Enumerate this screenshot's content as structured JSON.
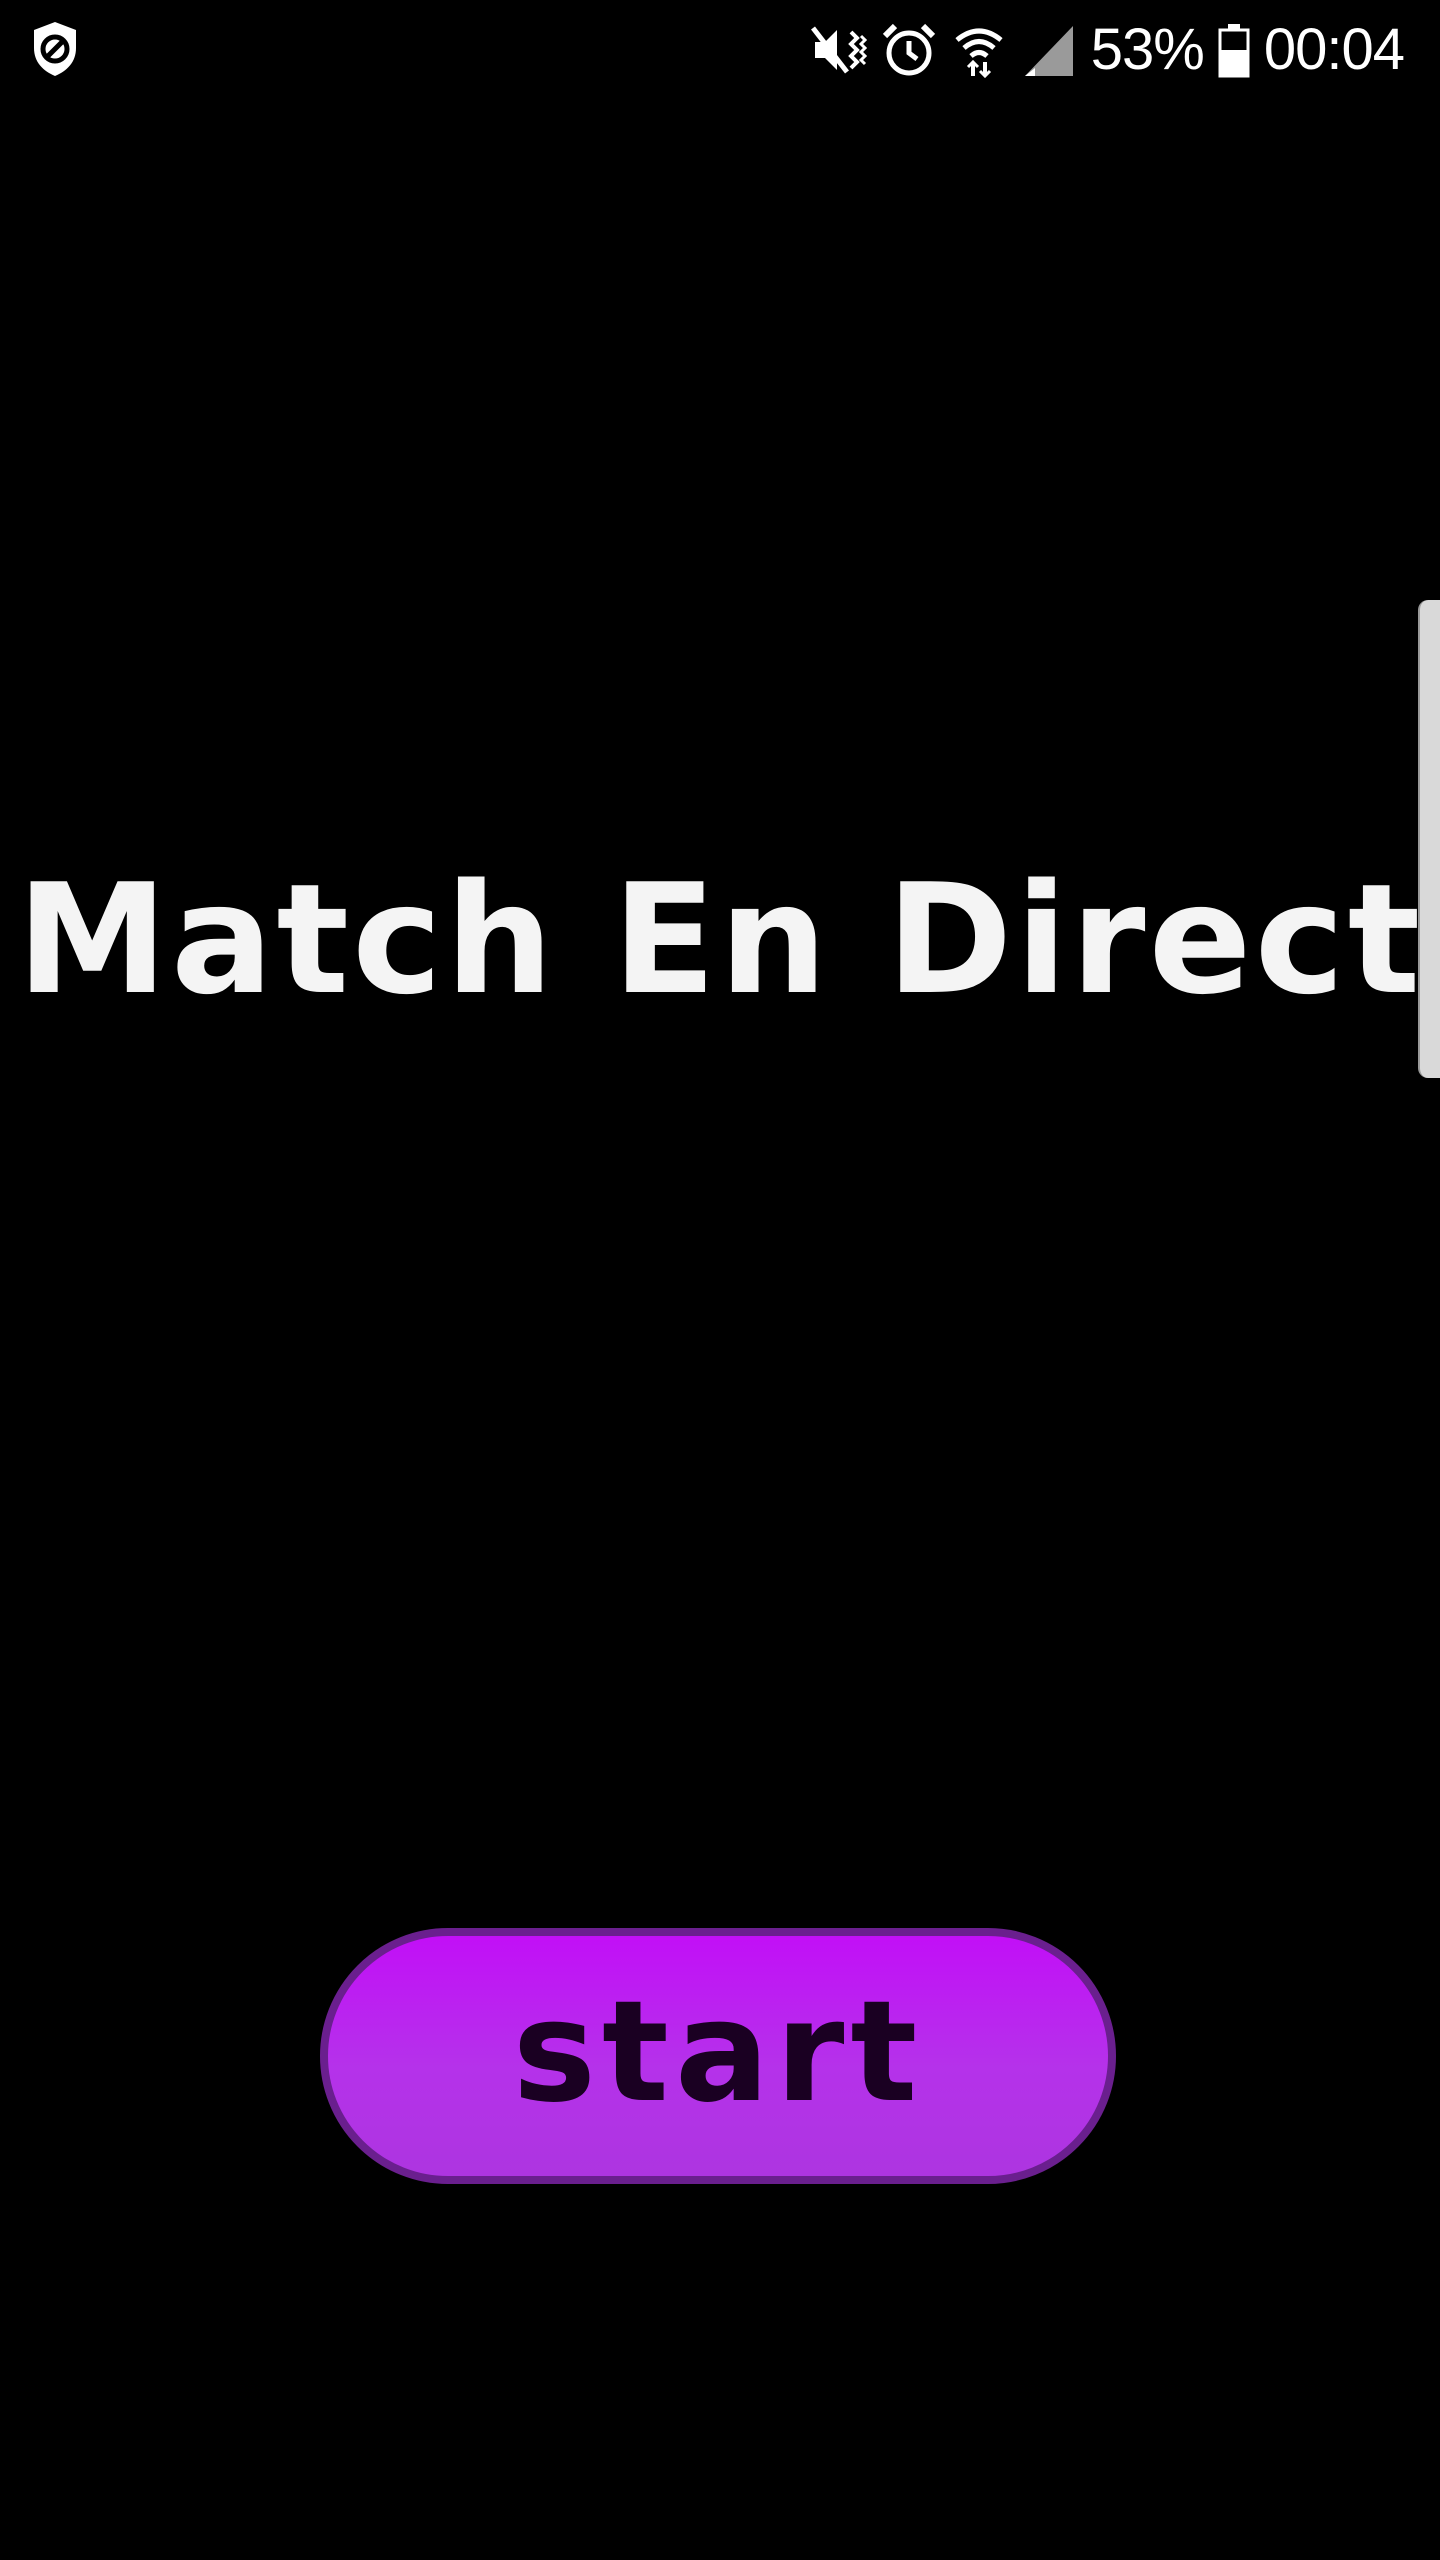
{
  "status_bar": {
    "left_icon": "shield-block-icon",
    "icons": [
      "mute-vibrate-icon",
      "alarm-icon",
      "wifi-icon",
      "signal-icon",
      "battery-icon"
    ],
    "battery_percent": "53%",
    "time": "00:04"
  },
  "main": {
    "title": "Match En Direct",
    "start_button_label": "start"
  },
  "colors": {
    "background": "#000000",
    "title": "#f4f4f4",
    "button_fill": "#b532ea",
    "button_border": "#6a1f8e",
    "button_text": "#1a0022"
  }
}
